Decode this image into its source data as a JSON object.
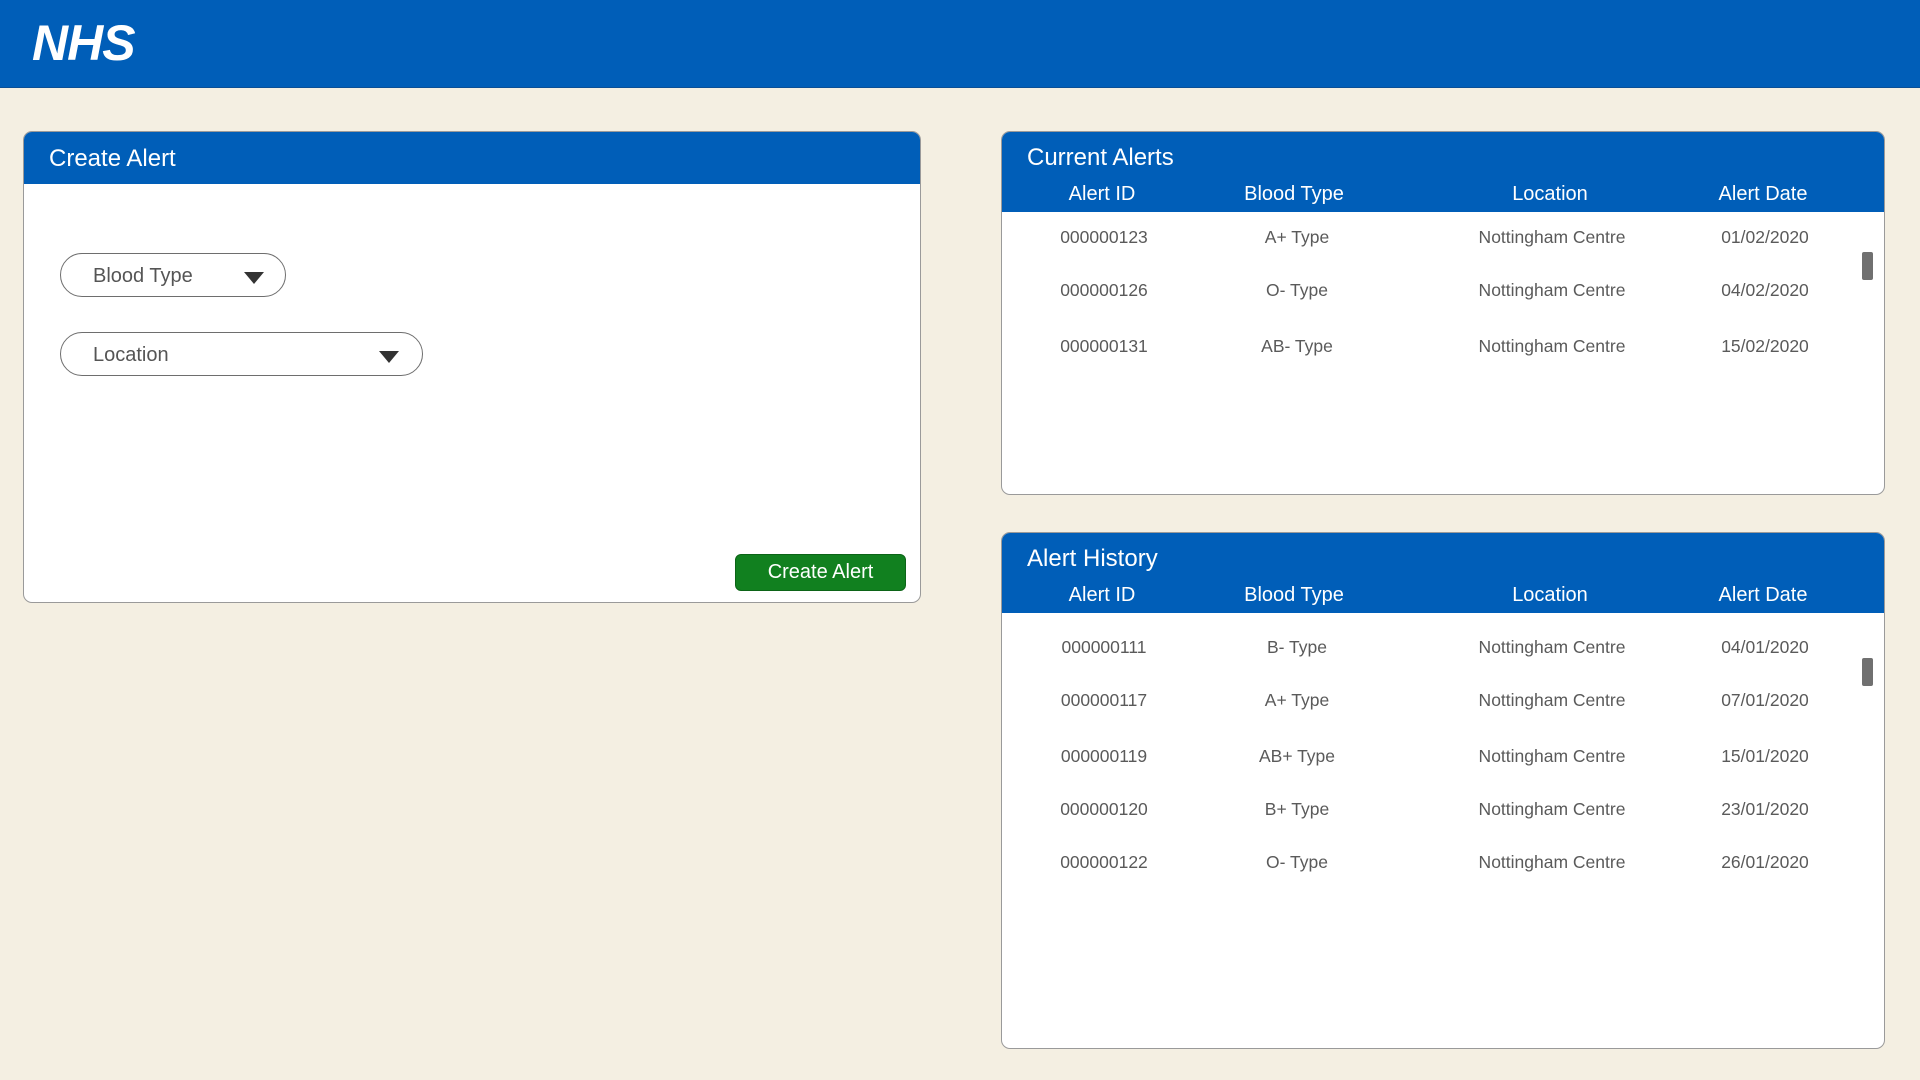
{
  "header": {
    "logo_text": "NHS"
  },
  "create_alert": {
    "title": "Create Alert",
    "blood_type_placeholder": "Blood Type",
    "location_placeholder": "Location",
    "submit_label": "Create Alert"
  },
  "current_alerts": {
    "title": "Current Alerts",
    "columns": [
      "Alert ID",
      "Blood Type",
      "Location",
      "Alert Date"
    ],
    "rows": [
      [
        "000000123",
        "A+ Type",
        "Nottingham Centre",
        "01/02/2020"
      ],
      [
        "000000126",
        "O- Type",
        "Nottingham Centre",
        "04/02/2020"
      ],
      [
        "000000131",
        "AB- Type",
        "Nottingham Centre",
        "15/02/2020"
      ]
    ]
  },
  "alert_history": {
    "title": "Alert History",
    "columns": [
      "Alert ID",
      "Blood Type",
      "Location",
      "Alert Date"
    ],
    "rows": [
      [
        "000000111",
        "B- Type",
        "Nottingham Centre",
        "04/01/2020"
      ],
      [
        "000000117",
        "A+ Type",
        "Nottingham Centre",
        "07/01/2020"
      ],
      [
        "000000119",
        "AB+ Type",
        "Nottingham Centre",
        "15/01/2020"
      ],
      [
        "000000120",
        "B+ Type",
        "Nottingham Centre",
        "23/01/2020"
      ],
      [
        "000000122",
        "O- Type",
        "Nottingham Centre",
        "26/01/2020"
      ]
    ]
  },
  "colors": {
    "nhs_blue": "#005eb8",
    "button_green": "#11801f",
    "page_background": "#f4efe2"
  }
}
